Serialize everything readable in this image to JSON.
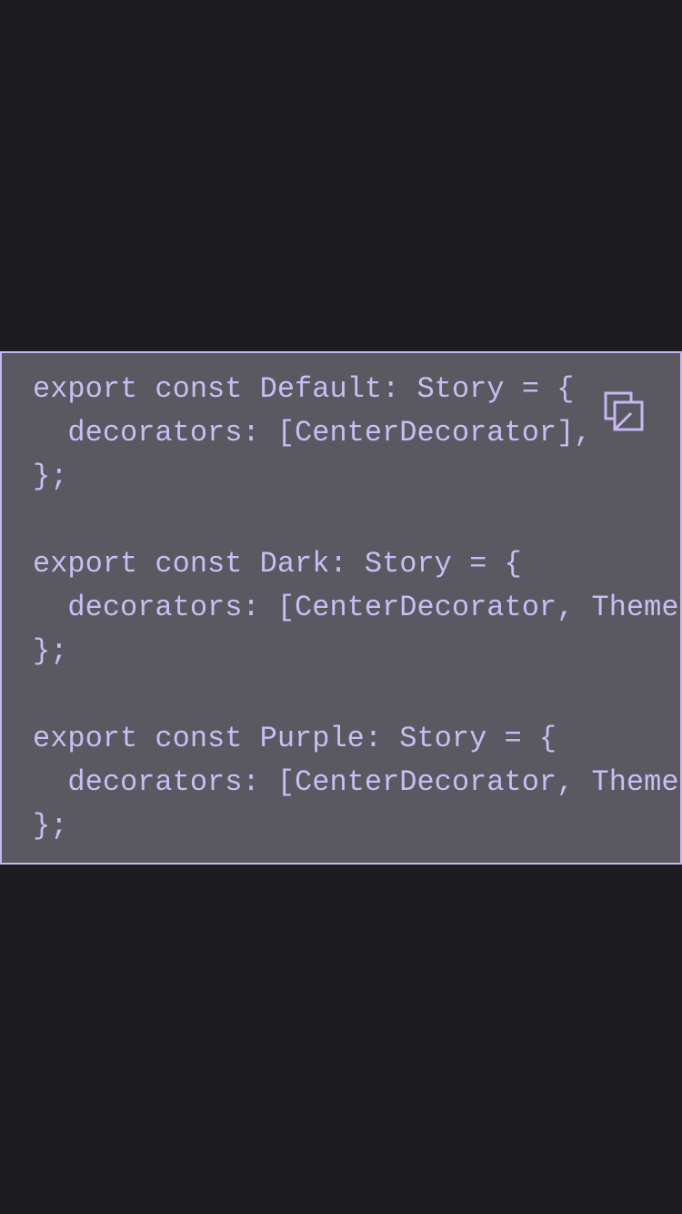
{
  "code_block": {
    "lines": [
      "export const Default: Story = {",
      "  decorators: [CenterDecorator],",
      "};",
      "",
      "export const Dark: Story = {",
      "  decorators: [CenterDecorator, ThemeD",
      "};",
      "",
      "export const Purple: Story = {",
      "  decorators: [CenterDecorator, ThemeD",
      "};"
    ]
  },
  "copy_button": {
    "icon": "copy-icon"
  },
  "colors": {
    "background": "#1d1c21",
    "code_background": "#5a5860",
    "accent": "#c6b8f2"
  }
}
